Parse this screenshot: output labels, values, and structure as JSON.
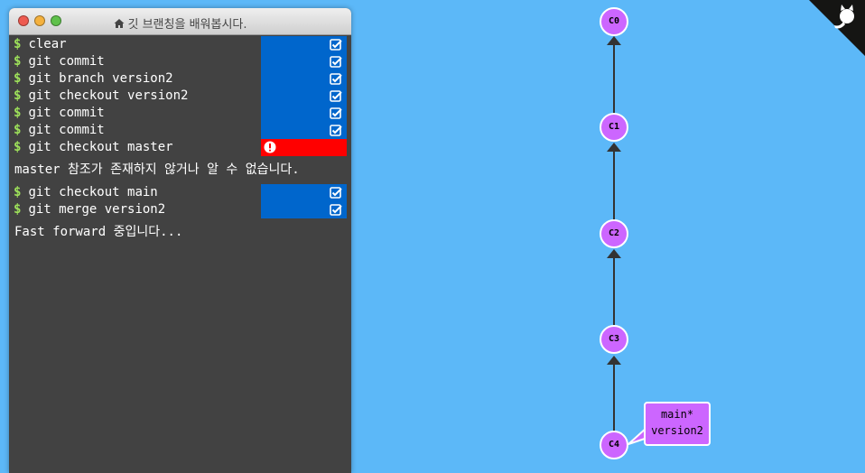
{
  "window": {
    "title": "깃 브랜칭을 배워봅시다."
  },
  "terminal": {
    "prompt": "$",
    "blocks": [
      {
        "commands": [
          {
            "text": "clear",
            "status": "ok"
          },
          {
            "text": "git commit",
            "status": "ok"
          },
          {
            "text": "git branch version2",
            "status": "ok"
          },
          {
            "text": "git checkout version2",
            "status": "ok"
          },
          {
            "text": "git commit",
            "status": "ok"
          },
          {
            "text": "git commit",
            "status": "ok"
          },
          {
            "text": "git checkout master",
            "status": "error"
          }
        ],
        "message": "master 참조가 존재하지 않거나 알 수 없습니다."
      },
      {
        "commands": [
          {
            "text": "git checkout main",
            "status": "ok"
          },
          {
            "text": "git merge version2",
            "status": "ok"
          }
        ],
        "message": "Fast forward 중입니다..."
      }
    ]
  },
  "tree": {
    "commits": [
      "C0",
      "C1",
      "C2",
      "C3",
      "C4"
    ],
    "branch_label": {
      "line1": "main*",
      "line2": "version2"
    }
  },
  "colors": {
    "background": "#5cb8f8",
    "terminal": "#424242",
    "ok": "#0066cc",
    "error": "#ff0000",
    "commit": "#cc66ff"
  },
  "icons": {
    "title": "home-icon",
    "ok": "checkbox-checked-icon",
    "error": "exclamation-circle-icon",
    "corner": "octocat-icon"
  }
}
